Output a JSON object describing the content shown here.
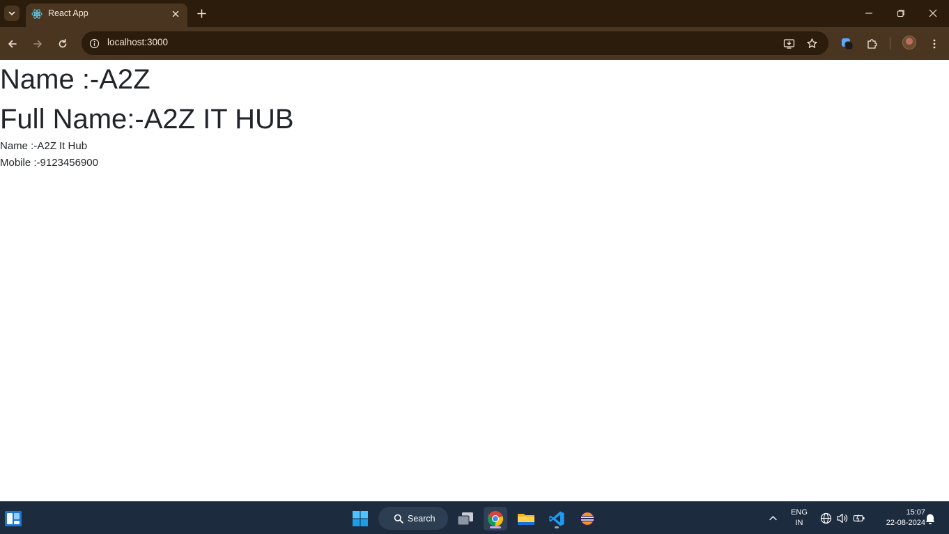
{
  "browser": {
    "tab_title": "React App",
    "url": "localhost:3000",
    "theme": {
      "frame": "#2b1c0c",
      "toolbar": "#4a3520",
      "text": "#f1e6da"
    }
  },
  "page": {
    "heading_name": "Name :-A2Z",
    "heading_full_name": "Full Name:-A2Z IT HUB",
    "line_name": "Name :-A2Z It Hub",
    "line_mobile": "Mobile :-9123456900"
  },
  "taskbar": {
    "search_label": "Search",
    "language_top": "ENG",
    "language_bottom": "IN",
    "time": "15:07",
    "date": "22-08-2024",
    "pinned_icons": [
      "start-icon",
      "search-icon",
      "task-view-icon",
      "chrome-icon",
      "file-explorer-icon",
      "vscode-icon",
      "eclipse-icon"
    ],
    "accent": "#4cc2ff"
  }
}
